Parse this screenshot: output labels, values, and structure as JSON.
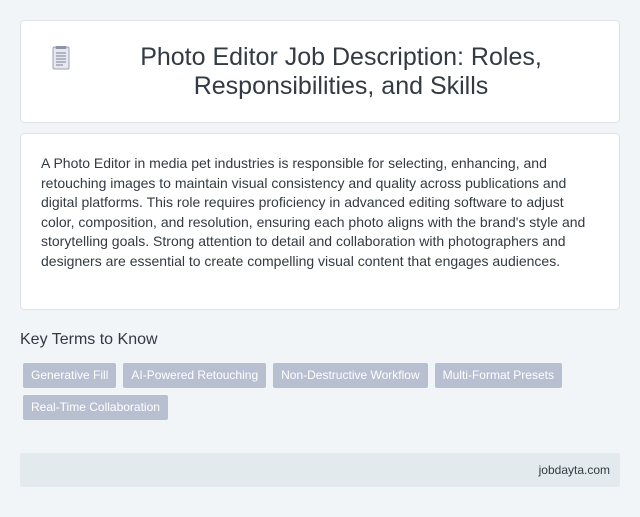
{
  "header": {
    "icon": "document-icon",
    "title": "Photo Editor Job Description: Roles, Responsibilities, and Skills"
  },
  "description": "A Photo Editor in media pet industries is responsible for selecting, enhancing, and retouching images to maintain visual consistency and quality across publications and digital platforms. This role requires proficiency in advanced editing software to adjust color, composition, and resolution, ensuring each photo aligns with the brand's style and storytelling goals. Strong attention to detail and collaboration with photographers and designers are essential to create compelling visual content that engages audiences.",
  "key_terms": {
    "title": "Key Terms to Know",
    "tags": [
      "Generative Fill",
      "AI-Powered Retouching",
      "Non-Destructive Workflow",
      "Multi-Format Presets",
      "Real-Time Collaboration"
    ]
  },
  "footer": {
    "site": "jobdayta.com"
  },
  "colors": {
    "background": "#f2f5f8",
    "card": "#ffffff",
    "tag": "#b8bfd1",
    "footer": "#e3eaee",
    "text": "#333a42"
  }
}
